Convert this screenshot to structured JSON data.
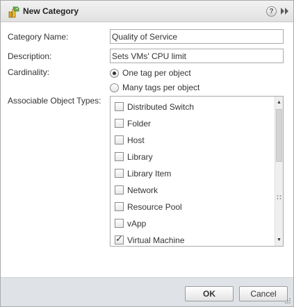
{
  "dialog": {
    "title": "New Category",
    "help_label": "?"
  },
  "form": {
    "category_name": {
      "label": "Category Name:",
      "value": "Quality of Service"
    },
    "description": {
      "label": "Description:",
      "value": "Sets VMs' CPU limit"
    },
    "cardinality": {
      "label": "Cardinality:",
      "options": [
        {
          "label": "One tag per object",
          "selected": true
        },
        {
          "label": "Many tags per object",
          "selected": false
        }
      ]
    },
    "object_types": {
      "label": "Associable Object Types:",
      "items": [
        {
          "label": "Distributed Switch",
          "checked": false
        },
        {
          "label": "Folder",
          "checked": false
        },
        {
          "label": "Host",
          "checked": false
        },
        {
          "label": "Library",
          "checked": false
        },
        {
          "label": "Library Item",
          "checked": false
        },
        {
          "label": "Network",
          "checked": false
        },
        {
          "label": "Resource Pool",
          "checked": false
        },
        {
          "label": "vApp",
          "checked": false
        },
        {
          "label": "Virtual Machine",
          "checked": true
        }
      ]
    }
  },
  "footer": {
    "ok_label": "OK",
    "cancel_label": "Cancel"
  },
  "icons": {
    "title_icon": "tag-category-icon",
    "expand_icon": "double-chevron-right-icon",
    "scroll_up": "up-arrow-icon",
    "scroll_down": "down-arrow-icon"
  }
}
